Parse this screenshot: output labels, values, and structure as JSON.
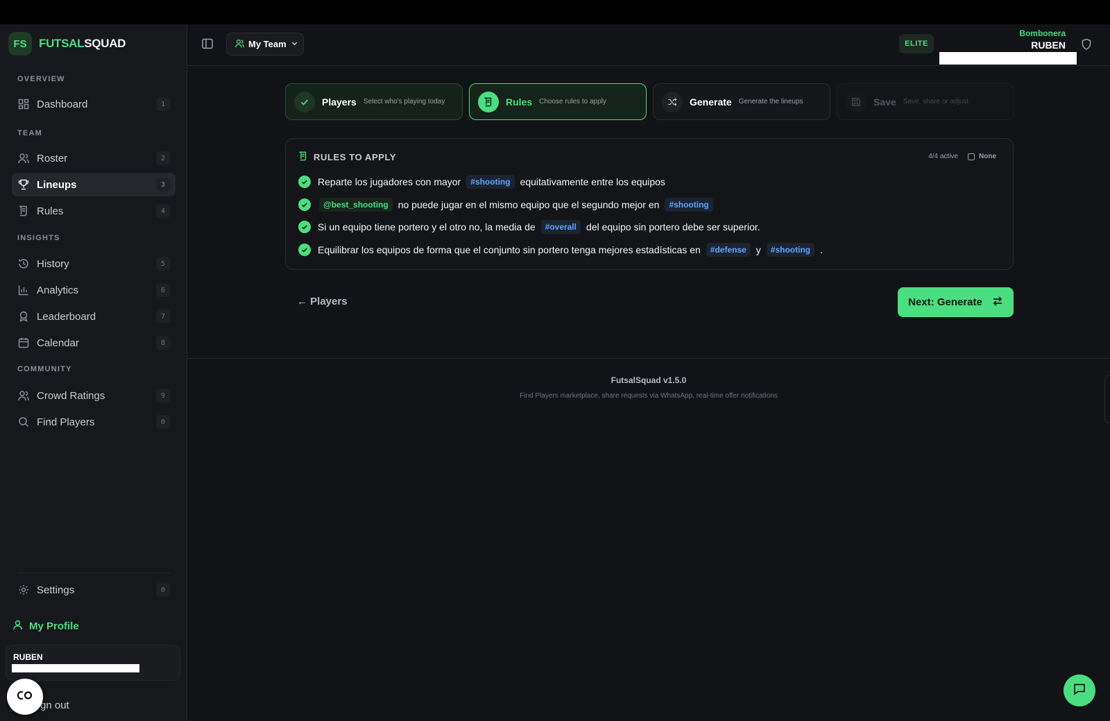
{
  "app": {
    "logo_initials": "FS",
    "name_part1": "FUTSAL",
    "name_part2": "SQUAD"
  },
  "sidebar": {
    "sections": {
      "overview": "OVERVIEW",
      "team": "TEAM",
      "insights": "INSIGHTS",
      "community": "COMMUNITY"
    },
    "items": [
      {
        "label": "Dashboard",
        "num": "1",
        "icon": "dashboard-icon"
      },
      {
        "label": "Roster",
        "num": "2",
        "icon": "users-icon"
      },
      {
        "label": "Lineups",
        "num": "3",
        "icon": "trophy-icon"
      },
      {
        "label": "Rules",
        "num": "4",
        "icon": "scroll-icon"
      },
      {
        "label": "History",
        "num": "5",
        "icon": "history-icon"
      },
      {
        "label": "Analytics",
        "num": "6",
        "icon": "bar-chart-icon"
      },
      {
        "label": "Leaderboard",
        "num": "7",
        "icon": "award-icon"
      },
      {
        "label": "Calendar",
        "num": "8",
        "icon": "calendar-icon"
      },
      {
        "label": "Crowd Ratings",
        "num": "9",
        "icon": "users-icon"
      },
      {
        "label": "Find Players",
        "num": "0",
        "icon": "search-icon"
      },
      {
        "label": "Settings",
        "num": "0",
        "icon": "gear-icon"
      }
    ],
    "profile_label": "My Profile",
    "user_name": "RUBEN",
    "signout_label": "gn out"
  },
  "header": {
    "team_select": "My Team",
    "badge": "ELITE",
    "club_name": "Bombonera",
    "user_name": "RUBEN"
  },
  "steps": [
    {
      "title": "Players",
      "sub": "Select who's playing today",
      "state": "done"
    },
    {
      "title": "Rules",
      "sub": "Choose rules to apply",
      "state": "current"
    },
    {
      "title": "Generate",
      "sub": "Generate the lineups",
      "state": "next"
    },
    {
      "title": "Save",
      "sub": "Save, share or adjust",
      "state": "disabled"
    }
  ],
  "rules": {
    "title": "RULES TO APPLY",
    "active_count": "4/4 active",
    "none_label": "None",
    "r1": {
      "pre": "Reparte los jugadores con mayor",
      "tag": "#shooting",
      "post": "equitativamente entre los equipos"
    },
    "r2": {
      "tag1": "@best_shooting",
      "mid": "no puede jugar en el mismo equipo que el segundo mejor en",
      "tag2": "#shooting"
    },
    "r3": {
      "pre": "Si un equipo tiene portero y el otro no, la media de",
      "tag": "#overall",
      "post": "del equipo sin portero debe ser superior."
    },
    "r4": {
      "pre": "Equilibrar los equipos de forma que el conjunto sin portero tenga mejores estadísticas en",
      "tag1": "#defense",
      "mid": "y",
      "tag2": "#shooting",
      "post": "."
    }
  },
  "nav": {
    "back_label": "← Players",
    "next_label": "Next: Generate"
  },
  "footer": {
    "version": "FutsalSquad v1.5.0",
    "description": "Find Players marketplace, share requests via WhatsApp, real-time offer notifications"
  },
  "colors": {
    "accent": "#4ade80",
    "tag_blue": "#60a5fa",
    "background": "#121316"
  }
}
